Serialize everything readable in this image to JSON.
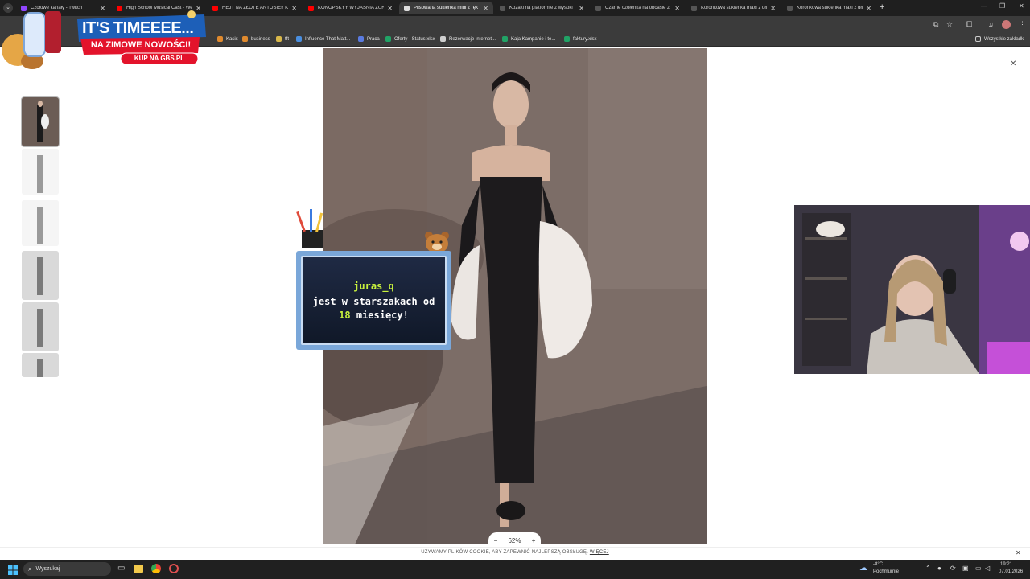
{
  "browser": {
    "tabs": [
      {
        "label": "Czołowe kanały - Twitch",
        "favicon_color": "#9146ff"
      },
      {
        "label": "High School Musical Cast - We",
        "favicon_color": "#ff0000"
      },
      {
        "label": "HEJT NA ZŁOTE ANTOSIE!! KO",
        "favicon_color": "#ff0000"
      },
      {
        "label": "KONOPSKYY WYJAŚNIA ŻURN",
        "favicon_color": "#ff0000"
      },
      {
        "label": "Plisowana sukienka midi z ręk",
        "favicon_color": "#dddddd"
      },
      {
        "label": "Kozaki na platformie z wysoki",
        "favicon_color": "#555555"
      },
      {
        "label": "Czarne czółenka na obcasie z p",
        "favicon_color": "#555555"
      },
      {
        "label": "Koronkowa sukienka maxi z dłu",
        "favicon_color": "#555555"
      },
      {
        "label": "Koronkowa sukienka maxi z dłu",
        "favicon_color": "#555555"
      }
    ],
    "active_tab_index": 4,
    "new_tab_icon": "plus-icon",
    "bookmarks": [
      {
        "label": "Kasix",
        "icon_color": "#e08a2e"
      },
      {
        "label": "business",
        "icon_color": "#e08a2e"
      },
      {
        "label": "tft",
        "icon_color": "#d9b84a"
      },
      {
        "label": "Influence That Matt...",
        "icon_color": "#4a8fe0"
      },
      {
        "label": "Praca",
        "icon_color": "#5a7be0"
      },
      {
        "label": "Oferty - Status.xlsx",
        "icon_color": "#21a366"
      },
      {
        "label": "Rezerwacje internet...",
        "icon_color": "#cfcfcf"
      },
      {
        "label": "Kaja Kampanie i te...",
        "icon_color": "#21a366"
      },
      {
        "label": "faktury.xlsx",
        "icon_color": "#21a366"
      }
    ],
    "all_bookmarks_label": "Wszystkie zakładki"
  },
  "promo": {
    "headline": "IT'S TIMEEEE...",
    "subline": "NA ZIMOWE NOWOŚCI!",
    "cta": "KUP NA GBS.PL"
  },
  "product_gallery": {
    "thumbnail_count": 6,
    "selected_index": 0,
    "close_icon": "close-icon"
  },
  "zoom": {
    "minus": "−",
    "value": "62%",
    "plus": "+"
  },
  "cookie": {
    "text": "UŻYWAMY PLIKÓW COOKIE, ABY ZAPEWNIĆ NAJLEPSZĄ OBSŁUGĘ.",
    "link": "WIĘCEJ"
  },
  "sub_alert": {
    "username": "juras_q",
    "line1": "jest w starszakach od",
    "months": "18",
    "line2_suffix": "miesięcy!"
  },
  "taskbar": {
    "search_placeholder": "Wyszukaj",
    "weather_temp": "-8°C",
    "weather_desc": "Pochmurnie",
    "time": "19:21",
    "date": "07.01.2026"
  },
  "colors": {
    "tabstrip": "#1f1f1f",
    "toolbar": "#3b3b3b",
    "promo_red": "#e3132b",
    "promo_blue": "#1d5fb8",
    "alert_frame": "#7aa7d9",
    "alert_highlight": "#c8f23d"
  }
}
